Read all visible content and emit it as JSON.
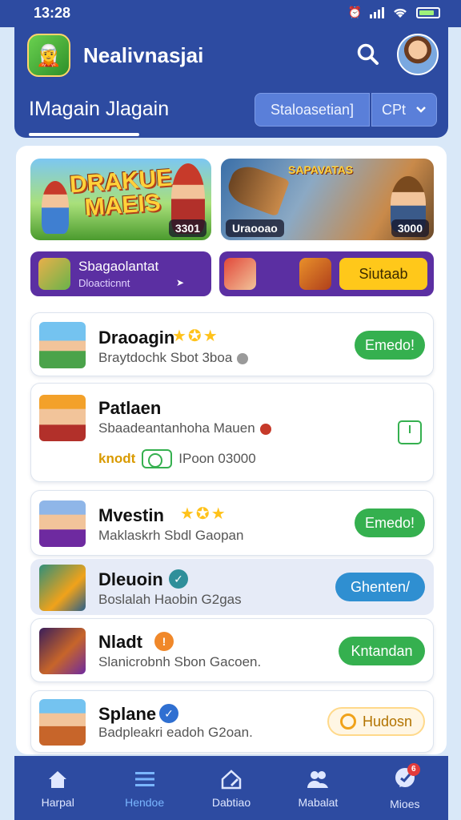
{
  "status_bar": {
    "time": "13:28"
  },
  "header": {
    "title": "Nealivnasjai",
    "subtitle": "IMagain Jlagain",
    "tab_select": "Staloasetian]",
    "tab_dropdown": "CPt"
  },
  "banners": [
    {
      "logo_line1": "DRAKUE",
      "logo_line2": "MAEIS",
      "badge": "3301"
    },
    {
      "logo": "SAPAVATAS",
      "badge_left": "Uraooao",
      "badge_right": "3000"
    }
  ],
  "promos": {
    "left": {
      "title": "Sbagaolantat",
      "subtitle": "Dloacticnnt"
    },
    "right": {
      "cta": "Siutaab"
    }
  },
  "games": [
    {
      "name": "Draoagin",
      "subtitle": "Braytdochk Sbot 3boa",
      "action": "Emedo!"
    },
    {
      "name": "Patlaen",
      "subtitle": "Sbaadeantanhoha Mauen",
      "tag": "knodt",
      "rating": "IPoon 03000"
    },
    {
      "name": "Mvestin",
      "subtitle": "Maklaskrh Sbdl Gaopan",
      "action": "Emedo!"
    },
    {
      "name": "Dleuoin",
      "subtitle": "Boslalah Haobin G2gas",
      "action": "Ghenten/"
    },
    {
      "name": "Nladt",
      "subtitle": "Slanicrobnh Sbon Gacoen.",
      "action": "Kntandan"
    },
    {
      "name": "Splane",
      "subtitle": "Badpleakri eadoh G2oan.",
      "action": "Hudosn"
    }
  ],
  "nav": [
    {
      "label": "Harpal"
    },
    {
      "label": "Hendoe"
    },
    {
      "label": "Dabtiao"
    },
    {
      "label": "Mabalat"
    },
    {
      "label": "Mioes",
      "badge": "6"
    }
  ],
  "colors": {
    "primary": "#2d4ba1",
    "accent_green": "#35b04f",
    "accent_blue": "#2f8fd1",
    "accent_yellow": "#ffc81a",
    "promo_purple": "#5b2fa2"
  }
}
